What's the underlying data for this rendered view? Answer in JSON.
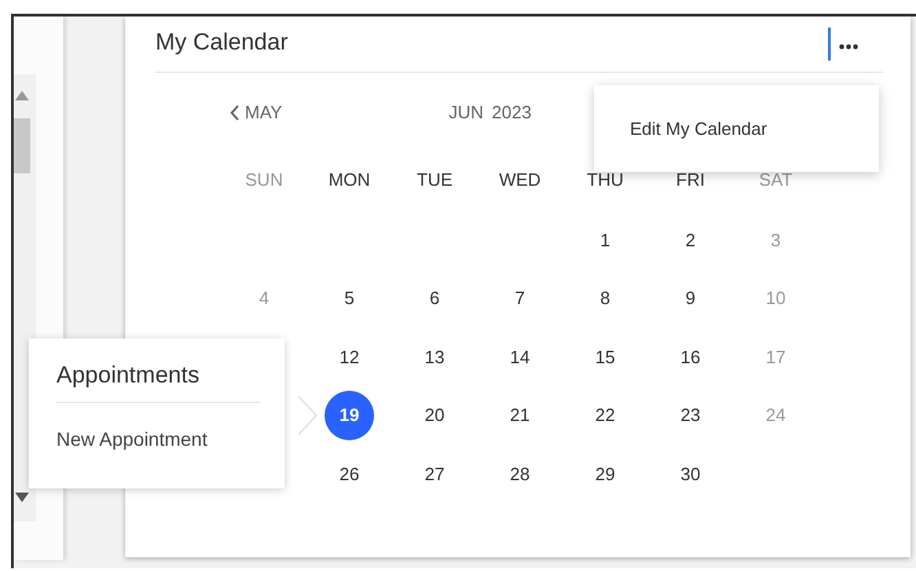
{
  "card": {
    "title": "My Calendar",
    "more_button": {
      "focused": true
    }
  },
  "nav": {
    "previous": "MAY",
    "current_month": "JUN",
    "current_year": "2023"
  },
  "weekdays": [
    {
      "label": "SUN",
      "muted": true
    },
    {
      "label": "MON",
      "muted": false
    },
    {
      "label": "TUE",
      "muted": false
    },
    {
      "label": "WED",
      "muted": false
    },
    {
      "label": "THU",
      "muted": false
    },
    {
      "label": "FRI",
      "muted": false
    },
    {
      "label": "SAT",
      "muted": true
    }
  ],
  "weeks": [
    {
      "thu": {
        "label": "1",
        "muted": false,
        "selected": false
      },
      "fri": {
        "label": "2",
        "muted": false,
        "selected": false
      },
      "sat": {
        "label": "3",
        "muted": true,
        "selected": false
      }
    },
    {
      "sun": {
        "label": "4",
        "muted": true,
        "selected": false
      },
      "mon": {
        "label": "5",
        "muted": false,
        "selected": false
      },
      "tue": {
        "label": "6",
        "muted": false,
        "selected": false
      },
      "wed": {
        "label": "7",
        "muted": false,
        "selected": false
      },
      "thu": {
        "label": "8",
        "muted": false,
        "selected": false
      },
      "fri": {
        "label": "9",
        "muted": false,
        "selected": false
      },
      "sat": {
        "label": "10",
        "muted": true,
        "selected": false
      }
    },
    {
      "mon": {
        "label": "12",
        "muted": false,
        "selected": false
      },
      "tue": {
        "label": "13",
        "muted": false,
        "selected": false
      },
      "wed": {
        "label": "14",
        "muted": false,
        "selected": false
      },
      "thu": {
        "label": "15",
        "muted": false,
        "selected": false
      },
      "fri": {
        "label": "16",
        "muted": false,
        "selected": false
      },
      "sat": {
        "label": "17",
        "muted": true,
        "selected": false
      }
    },
    {
      "mon": {
        "label": "19",
        "muted": false,
        "selected": true
      },
      "tue": {
        "label": "20",
        "muted": false,
        "selected": false
      },
      "wed": {
        "label": "21",
        "muted": false,
        "selected": false
      },
      "thu": {
        "label": "22",
        "muted": false,
        "selected": false
      },
      "fri": {
        "label": "23",
        "muted": false,
        "selected": false
      },
      "sat": {
        "label": "24",
        "muted": true,
        "selected": false
      }
    },
    {
      "mon": {
        "label": "26",
        "muted": false,
        "selected": false
      },
      "tue": {
        "label": "27",
        "muted": false,
        "selected": false
      },
      "wed": {
        "label": "28",
        "muted": false,
        "selected": false
      },
      "thu": {
        "label": "29",
        "muted": false,
        "selected": false
      },
      "fri": {
        "label": "30",
        "muted": false,
        "selected": false
      }
    }
  ],
  "menu": {
    "items": [
      "Edit My Calendar"
    ]
  },
  "appointments_popup": {
    "title": "Appointments",
    "items": [
      "New Appointment"
    ]
  }
}
